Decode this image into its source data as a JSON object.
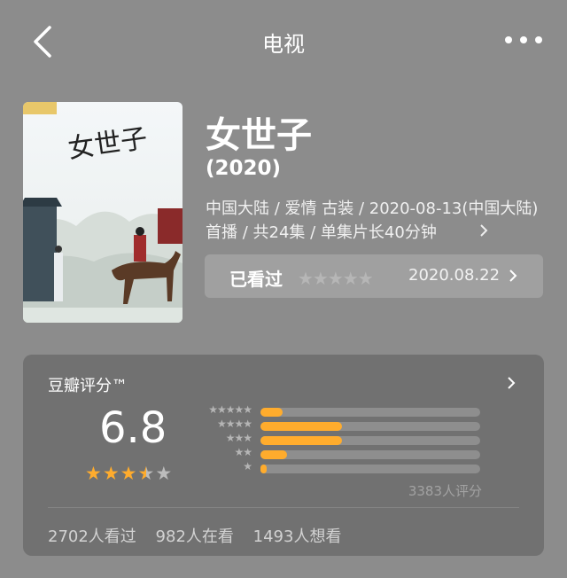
{
  "header": {
    "title": "电视"
  },
  "show": {
    "name": "女世子",
    "year": "(2020)",
    "meta": "中国大陆 / 爱情 古装 / 2020-08-13(中国大陆)首播 / 共24集 / 单集片长40分钟",
    "poster_title": "女世子"
  },
  "watched": {
    "label": "已看过",
    "stars": "★★★★★",
    "date": "2020.08.22"
  },
  "rating": {
    "title": "豆瓣评分™",
    "score": "6.8",
    "stars_value": 3.5,
    "distribution": [
      {
        "stars": "★★★★★",
        "fraction": 0.1
      },
      {
        "stars": "★★★★",
        "fraction": 0.37
      },
      {
        "stars": "★★★",
        "fraction": 0.37
      },
      {
        "stars": "★★",
        "fraction": 0.12
      },
      {
        "stars": "★",
        "fraction": 0.03
      }
    ],
    "raters": "3383人评分",
    "stats": [
      "2702人看过",
      "982人在看",
      "1493人想看"
    ]
  },
  "colors": {
    "accent": "#ffac2d",
    "background": "#8c8c8c",
    "card": "#717171"
  }
}
